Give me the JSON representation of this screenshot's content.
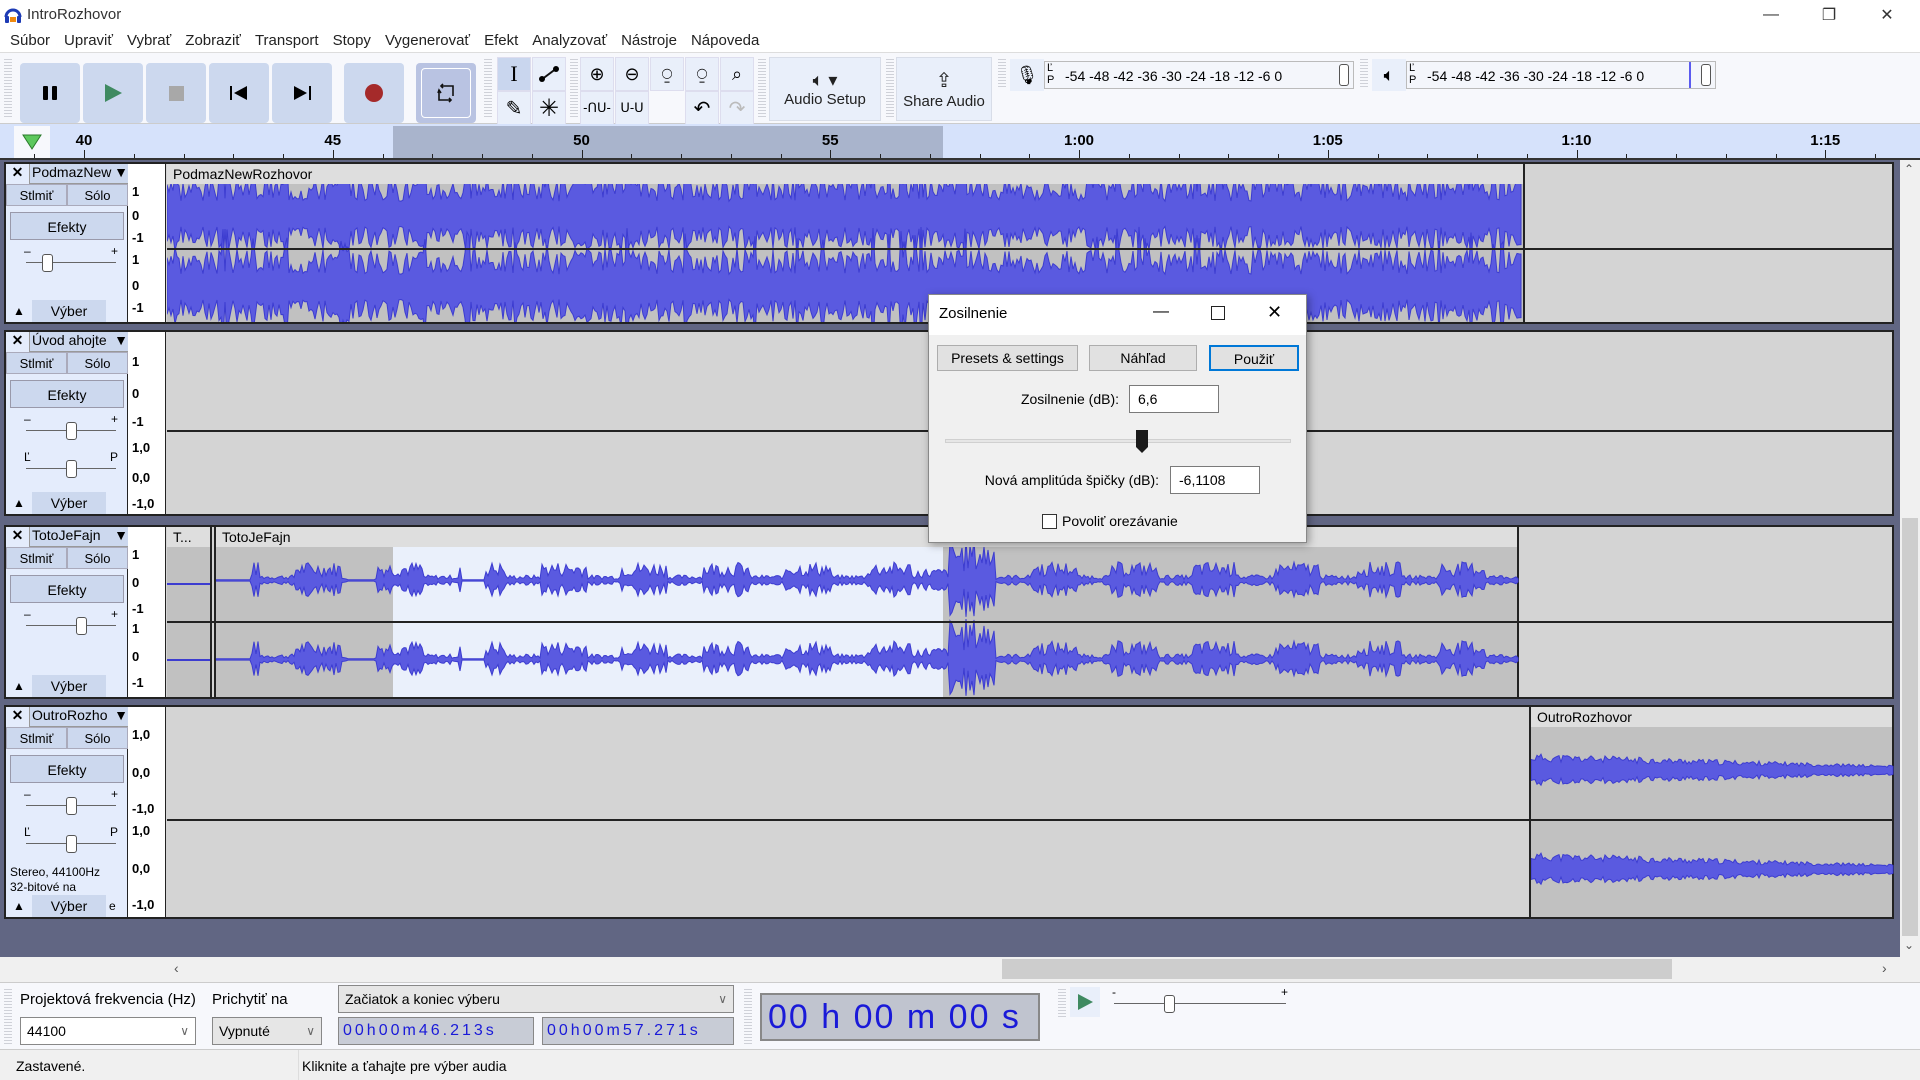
{
  "window": {
    "title": "IntroRozhovor",
    "minimize": "—",
    "maximize": "❐",
    "close": "✕"
  },
  "menu": [
    "Súbor",
    "Upraviť",
    "Vybrať",
    "Zobraziť",
    "Transport",
    "Stopy",
    "Vygenerovať",
    "Efekt",
    "Analyzovať",
    "Nástroje",
    "Nápoveda"
  ],
  "toolbar": {
    "audio_setup": "Audio Setup",
    "share_audio": "Share Audio",
    "meter_lp": [
      "Ľ",
      "P"
    ],
    "meter_scale": "-54  -48  -42  -36  -30  -24  -18  -12   -6   0",
    "transport_icons": [
      "pause-icon",
      "play-icon",
      "stop-icon",
      "skip-start-icon",
      "skip-end-icon",
      "record-icon",
      "loop-icon"
    ],
    "colors": {
      "play": "#3f8a61",
      "record": "#a52a2a",
      "stop": "#a8a8a8",
      "button_bg": "#ccd8ee",
      "loop_bg": "#b9c3e2"
    }
  },
  "ruler": {
    "labels": [
      "40",
      "45",
      "50",
      "55",
      "1:00",
      "1:05",
      "1:10",
      "1:15"
    ],
    "seconds": [
      40,
      45,
      50,
      55,
      60,
      65,
      70,
      75
    ],
    "selection_start_s": 46.213,
    "selection_end_s": 57.271
  },
  "tracks": [
    {
      "name": "PodmazNew",
      "clip": "PodmazNewRozhovor",
      "mute": "Stlmiť",
      "solo": "Sólo",
      "effects": "Efekty",
      "select": "Výber",
      "scale": [
        "1",
        "0",
        "-1"
      ],
      "scale2": [
        "1",
        "0",
        "-1"
      ]
    },
    {
      "name": "Úvod ahojte",
      "mute": "Stlmiť",
      "solo": "Sólo",
      "effects": "Efekty",
      "select": "Výber",
      "scale": [
        "1",
        "0",
        "-1"
      ],
      "scale2": [
        "1,0",
        "0,0",
        "-1,0"
      ],
      "pan_l": "Ľ",
      "pan_r": "P"
    },
    {
      "name": "TotoJeFajn",
      "clip_a": "T...",
      "clip": "TotoJeFajn",
      "mute": "Stlmiť",
      "solo": "Sólo",
      "effects": "Efekty",
      "select": "Výber",
      "scale": [
        "1",
        "0",
        "-1"
      ],
      "scale2": [
        "1",
        "0",
        "-1"
      ]
    },
    {
      "name": "OutroRozho",
      "clip": "OutroRozhovor",
      "mute": "Stlmiť",
      "solo": "Sólo",
      "effects": "Efekty",
      "select": "Výber",
      "scale": [
        "1,0",
        "0,0",
        "-1,0"
      ],
      "scale2": [
        "1,0",
        "0,0",
        "-1,0"
      ],
      "pan_l": "Ľ",
      "pan_r": "P",
      "info1": "Stereo, 44100Hz",
      "info2": "32-bitové na",
      "info3": "e"
    }
  ],
  "dialog": {
    "title": "Zosilnenie",
    "presets": "Presets & settings",
    "preview": "Náhľad",
    "apply": "Použiť",
    "amp_label": "Zosilnenie (dB):",
    "amp_value": "6,6",
    "amp_slider_fraction": 0.57,
    "peak_label": "Nová amplitúda špičky (dB):",
    "peak_value": "-6,1108",
    "clip_label": "Povoliť orezávanie",
    "clip_checked": false
  },
  "bottom": {
    "rate_label": "Projektová frekvencia (Hz)",
    "rate_value": "44100",
    "snap_label": "Prichytiť na",
    "snap_value": "Vypnuté",
    "sel_mode": "Začiatok a koniec výberu",
    "sel_start": "00h00m46.213s",
    "sel_end": "00h00m57.271s",
    "time": "00 h 00 m 00 s",
    "play_speed_minus": "-",
    "play_speed_plus": "+"
  },
  "status": {
    "left": "Zastavené.",
    "right": "Kliknite a ťahajte pre výber audia"
  }
}
